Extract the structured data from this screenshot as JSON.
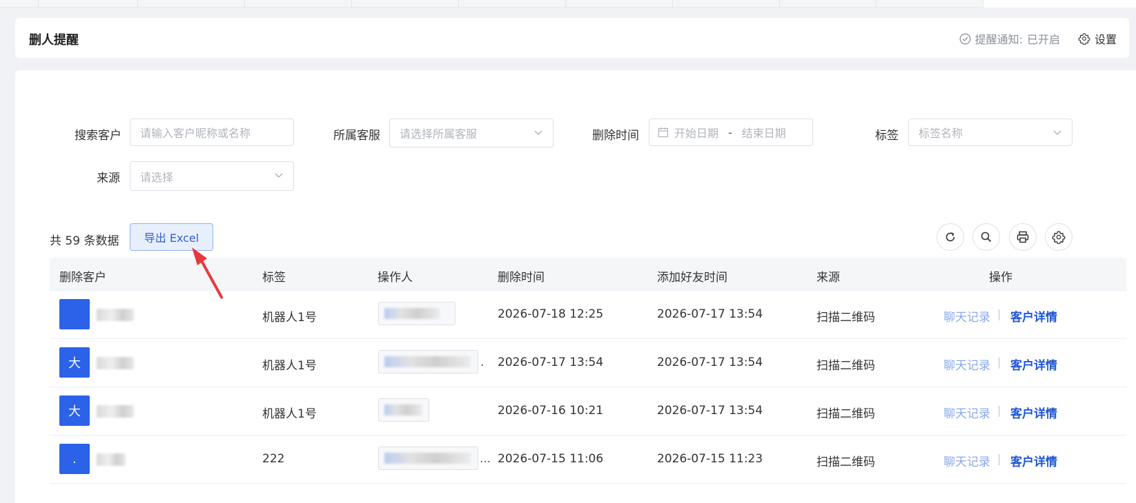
{
  "header": {
    "title": "删人提醒",
    "notify_label": "提醒通知:",
    "notify_status": "已开启",
    "settings_label": "设置"
  },
  "filters": {
    "customer_label": "搜索客户",
    "customer_placeholder": "请输入客户昵称或名称",
    "service_label": "所属客服",
    "service_placeholder": "请选择所属客服",
    "delete_time_label": "删除时间",
    "start_placeholder": "开始日期",
    "range_sep": "-",
    "end_placeholder": "结束日期",
    "tag_label": "标签",
    "tag_placeholder": "标签名称",
    "source_label": "来源",
    "source_placeholder": "请选择"
  },
  "toolbar": {
    "count_text": "共 59 条数据",
    "export_label": "导出 Excel"
  },
  "table": {
    "columns": [
      "删除客户",
      "标签",
      "操作人",
      "删除时间",
      "添加好友时间",
      "来源",
      "操作"
    ],
    "rows": [
      {
        "avatar": "",
        "tag": "机器人1号",
        "delete_time": "2026-07-18 12:25",
        "add_time": "2026-07-17 13:54",
        "source": "扫描二维码",
        "op_suffix": ""
      },
      {
        "avatar": "大",
        "tag": "机器人1号",
        "delete_time": "2026-07-17 13:54",
        "add_time": "2026-07-17 13:54",
        "source": "扫描二维码",
        "op_suffix": "."
      },
      {
        "avatar": "大",
        "tag": "机器人1号",
        "delete_time": "2026-07-16 10:21",
        "add_time": "2026-07-17 13:54",
        "source": "扫描二维码",
        "op_suffix": ""
      },
      {
        "avatar": ".",
        "tag": "222",
        "delete_time": "2026-07-15 11:06",
        "add_time": "2026-07-15 11:23",
        "source": "扫描二维码",
        "op_suffix": "..."
      }
    ],
    "chat_link": "聊天记录",
    "link_sep": "|",
    "detail_link": "客户详情"
  }
}
